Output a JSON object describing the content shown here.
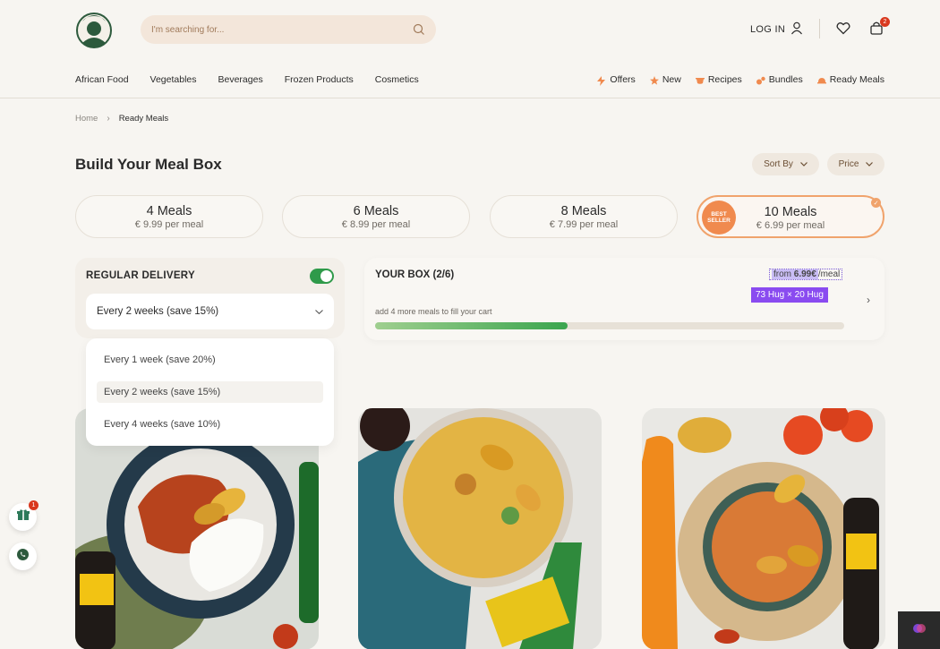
{
  "header": {
    "search_placeholder": "I'm searching for...",
    "login_label": "LOG IN",
    "cart_count": "2"
  },
  "nav": {
    "left": [
      "African Food",
      "Vegetables",
      "Beverages",
      "Frozen Products",
      "Cosmetics"
    ],
    "right": [
      {
        "label": "Offers",
        "icon": "bolt-icon"
      },
      {
        "label": "New",
        "icon": "star-icon"
      },
      {
        "label": "Recipes",
        "icon": "pot-icon"
      },
      {
        "label": "Bundles",
        "icon": "bundle-icon"
      },
      {
        "label": "Ready Meals",
        "icon": "dish-icon"
      }
    ]
  },
  "breadcrumb": {
    "home": "Home",
    "current": "Ready Meals"
  },
  "page": {
    "title": "Build Your Meal Box",
    "sort_label": "Sort By",
    "price_label": "Price"
  },
  "meal_options": [
    {
      "title": "4 Meals",
      "subtitle": "€ 9.99 per meal"
    },
    {
      "title": "6 Meals",
      "subtitle": "€ 8.99 per meal"
    },
    {
      "title": "8 Meals",
      "subtitle": "€ 7.99 per meal"
    },
    {
      "title": "10 Meals",
      "subtitle": "€ 6.99 per meal",
      "badge": "BEST SELLER"
    }
  ],
  "delivery": {
    "label": "REGULAR DELIVERY",
    "selected": "Every 2 weeks (save 15%)",
    "options": [
      "Every 1 week (save 20%)",
      "Every 2 weeks (save 15%)",
      "Every 4 weeks (save 10%)"
    ]
  },
  "box": {
    "label": "YOUR BOX (2/6)",
    "hint": "add 4 more meals to fill your cart",
    "progress": 0.41,
    "from_prefix": "from ",
    "from_price": "6.99€",
    "from_suffix": "/meal",
    "overlay": "73 Hug × 20 Hug"
  },
  "floating": {
    "gift_count": "1"
  },
  "colors": {
    "accent": "#f0a36c",
    "green": "#2f9a4a",
    "brand_green": "#2d5a3d"
  }
}
